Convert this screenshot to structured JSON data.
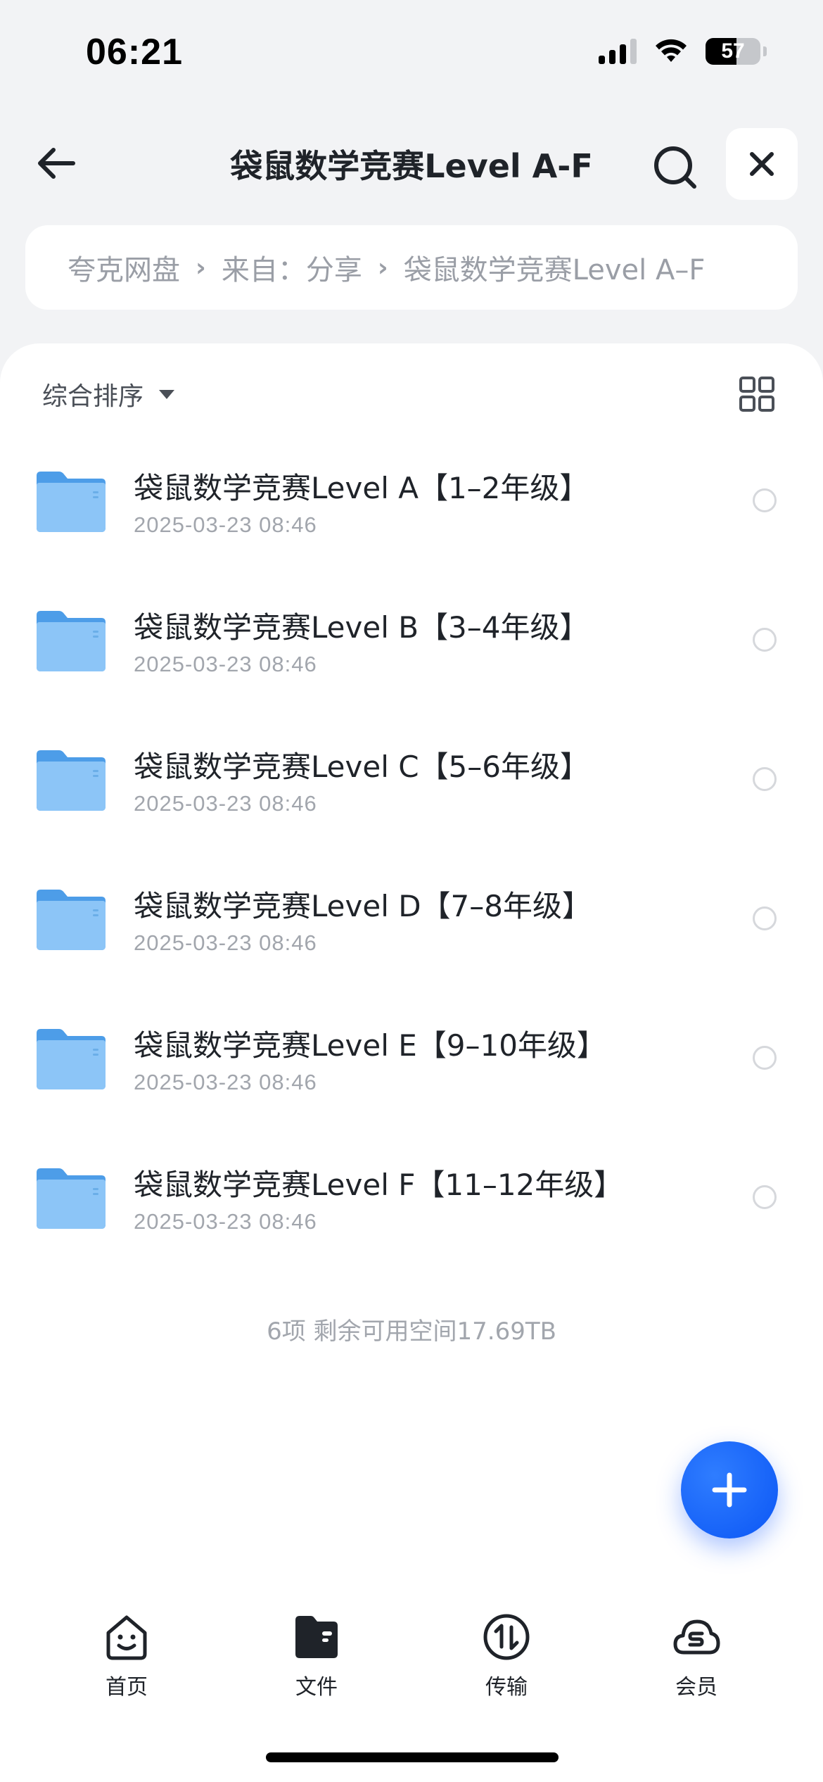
{
  "status_bar": {
    "time": "06:21",
    "battery_level": "57",
    "icons": [
      "cellular-signal-icon",
      "wifi-icon",
      "battery-icon"
    ]
  },
  "header": {
    "title": "袋鼠数学竞赛Level A-F",
    "icons": [
      "back-arrow-icon",
      "search-icon",
      "close-icon"
    ]
  },
  "breadcrumb": {
    "items": [
      "夸克网盘",
      "来自：分享",
      "袋鼠数学竞赛Level A–F"
    ]
  },
  "toolbar": {
    "sort_label": "综合排序",
    "view_toggle_icon": "grid-view-icon"
  },
  "files": [
    {
      "name": "袋鼠数学竞赛Level A【1–2年级】",
      "date": "2025-03-23 08:46"
    },
    {
      "name": "袋鼠数学竞赛Level B【3–4年级】",
      "date": "2025-03-23 08:46"
    },
    {
      "name": "袋鼠数学竞赛Level C【5–6年级】",
      "date": "2025-03-23 08:46"
    },
    {
      "name": "袋鼠数学竞赛Level D【7–8年级】",
      "date": "2025-03-23 08:46"
    },
    {
      "name": "袋鼠数学竞赛Level E【9–10年级】",
      "date": "2025-03-23 08:46"
    },
    {
      "name": "袋鼠数学竞赛Level F【11–12年级】",
      "date": "2025-03-23 08:46"
    }
  ],
  "footer": {
    "summary": "6项 剩余可用空间17.69TB"
  },
  "fab": {
    "icon": "plus-icon",
    "color": "#1a63ff"
  },
  "tab_bar": {
    "tabs": [
      {
        "label": "首页",
        "icon": "home-smiley-icon"
      },
      {
        "label": "文件",
        "icon": "folder-files-icon"
      },
      {
        "label": "传输",
        "icon": "transfer-arrows-icon"
      },
      {
        "label": "会员",
        "icon": "cloud-member-icon"
      }
    ]
  },
  "colors": {
    "accent": "#1a63ff",
    "folder": "#5aa9f0",
    "background": "#f2f3f5"
  }
}
